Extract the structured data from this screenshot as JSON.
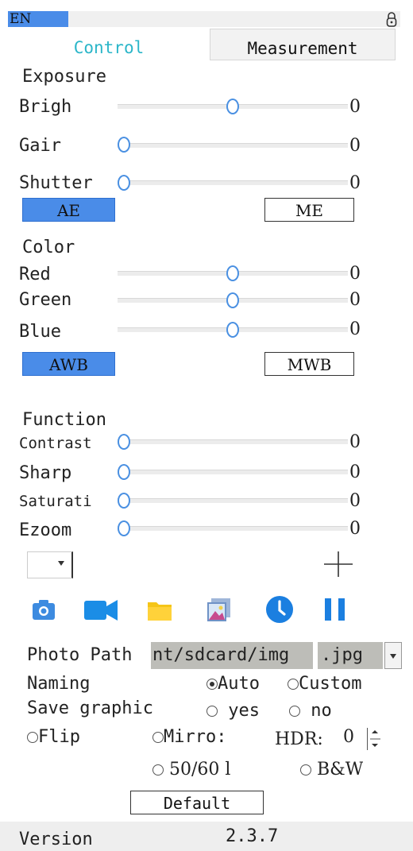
{
  "header": {
    "language": "EN",
    "lock_icon": "lock-icon"
  },
  "tabs": [
    {
      "label": "Control"
    },
    {
      "label": "Measurement"
    }
  ],
  "exposure": {
    "title": "Exposure",
    "sliders": [
      {
        "label": "Brigh",
        "value": "0",
        "position": 0.5
      },
      {
        "label": "Gair",
        "value": "0",
        "position": 0.0
      },
      {
        "label": "Shutter",
        "value": "0",
        "position": 0.0
      }
    ],
    "ae_label": "AE",
    "me_label": "ME"
  },
  "color": {
    "title": "Color",
    "sliders": [
      {
        "label": "Red",
        "value": "0",
        "position": 0.5
      },
      {
        "label": "Green",
        "value": "0",
        "position": 0.5
      },
      {
        "label": "Blue",
        "value": "0",
        "position": 0.5
      }
    ],
    "awb_label": "AWB",
    "mwb_label": "MWB"
  },
  "function": {
    "title": "Function",
    "sliders": [
      {
        "label": "Contrast",
        "value": "0",
        "position": 0.0
      },
      {
        "label": "Sharp",
        "value": "0",
        "position": 0.0
      },
      {
        "label": "Saturati",
        "value": "0",
        "position": 0.0
      },
      {
        "label": "Ezoom",
        "value": "0",
        "position": 0.0
      }
    ]
  },
  "toolbar": {
    "icons": [
      "camera-icon",
      "video-icon",
      "folder-icon",
      "gallery-icon",
      "clock-icon",
      "pause-icon"
    ]
  },
  "settings": {
    "photo_path_label": "Photo Path",
    "photo_path_value": "nt/sdcard/img",
    "format_value": ".jpg",
    "naming_label": "Naming",
    "naming_auto": "Auto",
    "naming_custom": "Custom",
    "save_graphic_label": "Save graphic",
    "save_yes": "yes",
    "save_no": "no",
    "flip": "Flip",
    "mirror": "Mirro:",
    "hdr_label": "HDR:",
    "hdr_value": "0",
    "freq": "50/60 l",
    "bw": "B&W",
    "default_label": "Default"
  },
  "footer": {
    "version_label": "Version",
    "version_value": "2.3.7"
  },
  "colors": {
    "accent": "#4a8ce8",
    "tab_active_text": "#2bb6c9"
  }
}
